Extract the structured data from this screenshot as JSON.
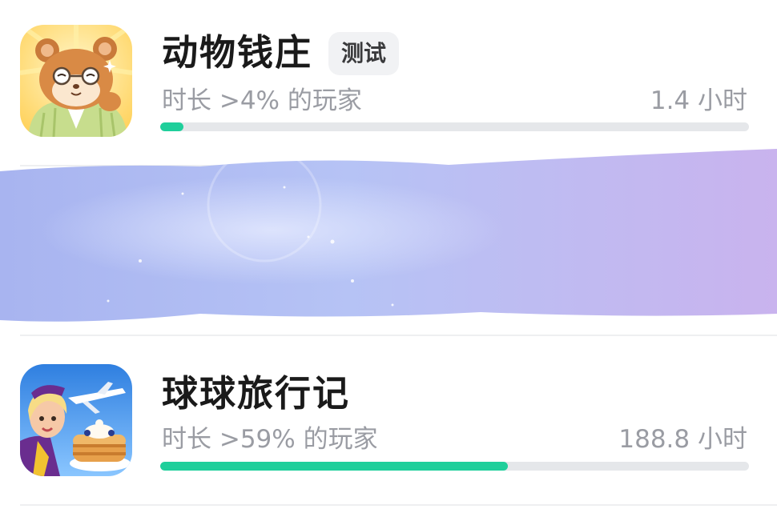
{
  "games": [
    {
      "title": "动物钱庄",
      "badge": "测试",
      "rank_text": "时长 >4% 的玩家",
      "hours_text": "1.4 小时",
      "progress_fraction": 0.04,
      "icon": "hamster-banker-icon"
    },
    {
      "title": "球球旅行记",
      "badge": "",
      "rank_text": "时长 >59% 的玩家",
      "hours_text": "188.8 小时",
      "progress_fraction": 0.59,
      "icon": "flight-attendant-pancakes-icon"
    }
  ],
  "colors": {
    "progress_fill": "#1fcf9b",
    "progress_track": "#e5e7ea",
    "redaction_start": "#a8b4f0",
    "redaction_end": "#c9b3ee"
  }
}
